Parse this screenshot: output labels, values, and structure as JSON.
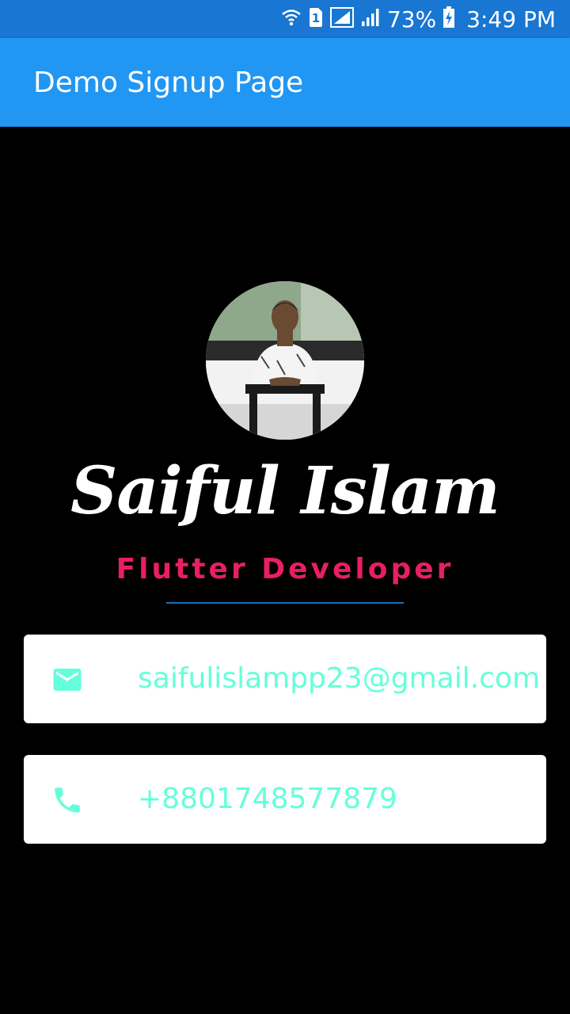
{
  "status_bar": {
    "battery": "73%",
    "time": "3:49 PM",
    "sim_badge": "1",
    "icons": [
      "wifi-icon",
      "sim-icon",
      "signal-icon",
      "signal-icon",
      "battery-charging-icon"
    ]
  },
  "app_bar": {
    "title": "Demo Signup Page",
    "color": "#2196F3"
  },
  "profile": {
    "name": "Saiful Islam",
    "role": "Flutter Developer",
    "role_color": "#E91E63"
  },
  "contacts": {
    "email": {
      "icon": "mail-icon",
      "value": "saifulislampp23@gmail.com"
    },
    "phone": {
      "icon": "phone-icon",
      "value": "+8801748577879"
    },
    "accent": "#64FFDA"
  }
}
